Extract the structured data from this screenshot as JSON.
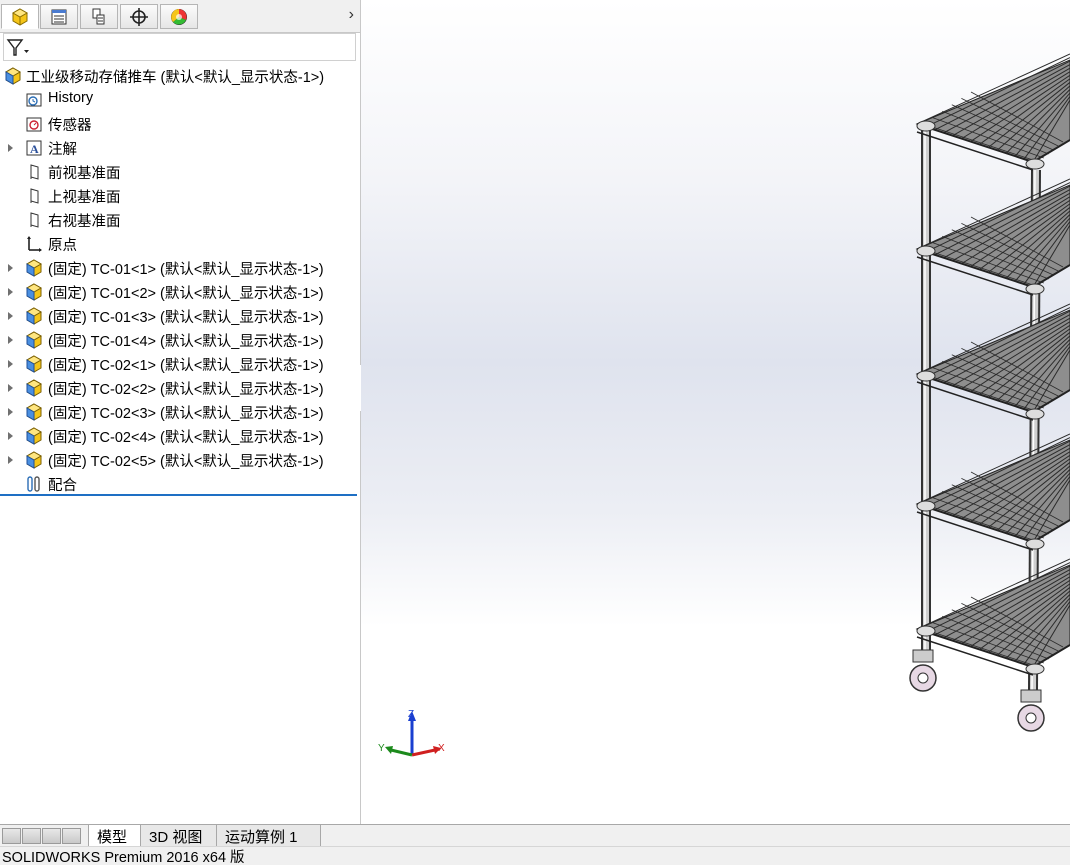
{
  "panel": {
    "tabs": [
      {
        "icon": "featuremanager-icon"
      },
      {
        "icon": "propertymanager-icon"
      },
      {
        "icon": "configurationmanager-icon"
      },
      {
        "icon": "dimxpert-icon"
      },
      {
        "icon": "display-manager-icon"
      }
    ],
    "more_icon": "chevron-right-icon",
    "filter_icon": "filter-icon"
  },
  "tree": {
    "root": "工业级移动存储推车 (默认<默认_显示状态-1>)",
    "items": [
      {
        "label": "History",
        "icon": "history-icon",
        "expandable": false
      },
      {
        "label": "传感器",
        "icon": "sensor-icon",
        "expandable": false
      },
      {
        "label": "注解",
        "icon": "annotation-icon",
        "expandable": true
      },
      {
        "label": "前视基准面",
        "icon": "plane-icon",
        "expandable": false
      },
      {
        "label": "上视基准面",
        "icon": "plane-icon",
        "expandable": false
      },
      {
        "label": "右视基准面",
        "icon": "plane-icon",
        "expandable": false
      },
      {
        "label": "原点",
        "icon": "origin-icon",
        "expandable": false
      },
      {
        "label": "(固定) TC-01<1> (默认<默认_显示状态-1>)",
        "icon": "part-icon",
        "expandable": true
      },
      {
        "label": "(固定) TC-01<2> (默认<默认_显示状态-1>)",
        "icon": "part-icon",
        "expandable": true
      },
      {
        "label": "(固定) TC-01<3> (默认<默认_显示状态-1>)",
        "icon": "part-icon",
        "expandable": true
      },
      {
        "label": "(固定) TC-01<4> (默认<默认_显示状态-1>)",
        "icon": "part-icon",
        "expandable": true
      },
      {
        "label": "(固定) TC-02<1> (默认<默认_显示状态-1>)",
        "icon": "part-icon",
        "expandable": true
      },
      {
        "label": "(固定) TC-02<2> (默认<默认_显示状态-1>)",
        "icon": "part-icon",
        "expandable": true
      },
      {
        "label": "(固定) TC-02<3> (默认<默认_显示状态-1>)",
        "icon": "part-icon",
        "expandable": true
      },
      {
        "label": "(固定) TC-02<4> (默认<默认_显示状态-1>)",
        "icon": "part-icon",
        "expandable": true
      },
      {
        "label": "(固定) TC-02<5> (默认<默认_显示状态-1>)",
        "icon": "part-icon",
        "expandable": true
      },
      {
        "label": "配合",
        "icon": "mates-icon",
        "expandable": false
      }
    ]
  },
  "triad": {
    "x": "X",
    "y": "Y",
    "z": "Z"
  },
  "bottom_tabs": [
    "模型",
    "3D 视图",
    "运动算例 1"
  ],
  "status": "SOLIDWORKS Premium 2016 x64 版"
}
